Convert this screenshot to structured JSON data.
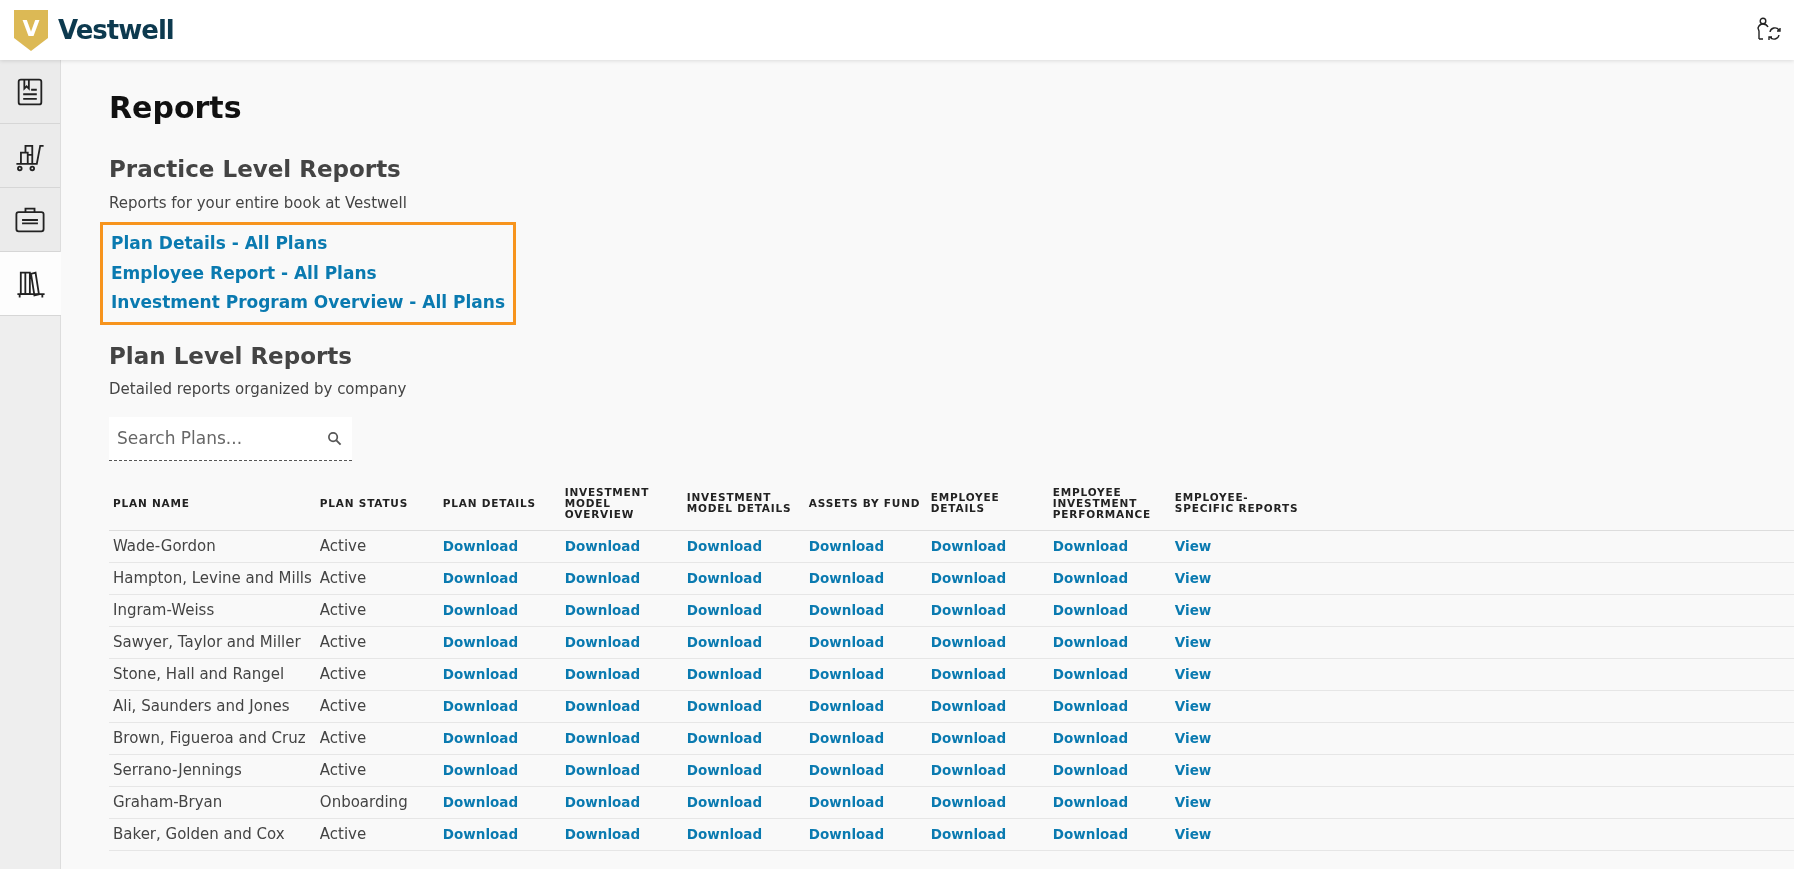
{
  "header": {
    "logo_letter": "V",
    "brand": "Vestwell"
  },
  "sidebar": {
    "items": [
      {
        "selected": false
      },
      {
        "selected": false
      },
      {
        "selected": false
      },
      {
        "selected": true
      }
    ]
  },
  "page_title": "Reports",
  "practice_reports": {
    "heading": "Practice Level Reports",
    "subtitle": "Reports for your entire book at Vestwell",
    "highlighted": true,
    "links": [
      "Plan Details - All Plans",
      "Employee Report - All Plans",
      "Investment Program Overview - All Plans"
    ]
  },
  "plan_reports": {
    "heading": "Plan Level Reports",
    "subtitle": "Detailed reports organized by company",
    "search": {
      "placeholder": "Search Plans..."
    },
    "table": {
      "columns": [
        "PLAN NAME",
        "PLAN STATUS",
        "PLAN DETAILS",
        "INVESTMENT MODEL OVERVIEW",
        "INVESTMENT MODEL DETAILS",
        "ASSETS BY FUND",
        "EMPLOYEE DETAILS",
        "EMPLOYEE INVESTMENT PERFORMANCE",
        "EMPLOYEE-SPECIFIC REPORTS"
      ],
      "rows": [
        [
          "Wade-Gordon",
          "Active",
          "Download",
          "Download",
          "Download",
          "Download",
          "Download",
          "Download",
          "View"
        ],
        [
          "Hampton, Levine and Mills",
          "Active",
          "Download",
          "Download",
          "Download",
          "Download",
          "Download",
          "Download",
          "View"
        ],
        [
          "Ingram-Weiss",
          "Active",
          "Download",
          "Download",
          "Download",
          "Download",
          "Download",
          "Download",
          "View"
        ],
        [
          "Sawyer, Taylor and Miller",
          "Active",
          "Download",
          "Download",
          "Download",
          "Download",
          "Download",
          "Download",
          "View"
        ],
        [
          "Stone, Hall and Rangel",
          "Active",
          "Download",
          "Download",
          "Download",
          "Download",
          "Download",
          "Download",
          "View"
        ],
        [
          "Ali, Saunders and Jones",
          "Active",
          "Download",
          "Download",
          "Download",
          "Download",
          "Download",
          "Download",
          "View"
        ],
        [
          "Brown, Figueroa and Cruz",
          "Active",
          "Download",
          "Download",
          "Download",
          "Download",
          "Download",
          "Download",
          "View"
        ],
        [
          "Serrano-Jennings",
          "Active",
          "Download",
          "Download",
          "Download",
          "Download",
          "Download",
          "Download",
          "View"
        ],
        [
          "Graham-Bryan",
          "Onboarding",
          "Download",
          "Download",
          "Download",
          "Download",
          "Download",
          "Download",
          "View"
        ],
        [
          "Baker, Golden and Cox",
          "Active",
          "Download",
          "Download",
          "Download",
          "Download",
          "Download",
          "Download",
          "View"
        ]
      ]
    }
  }
}
